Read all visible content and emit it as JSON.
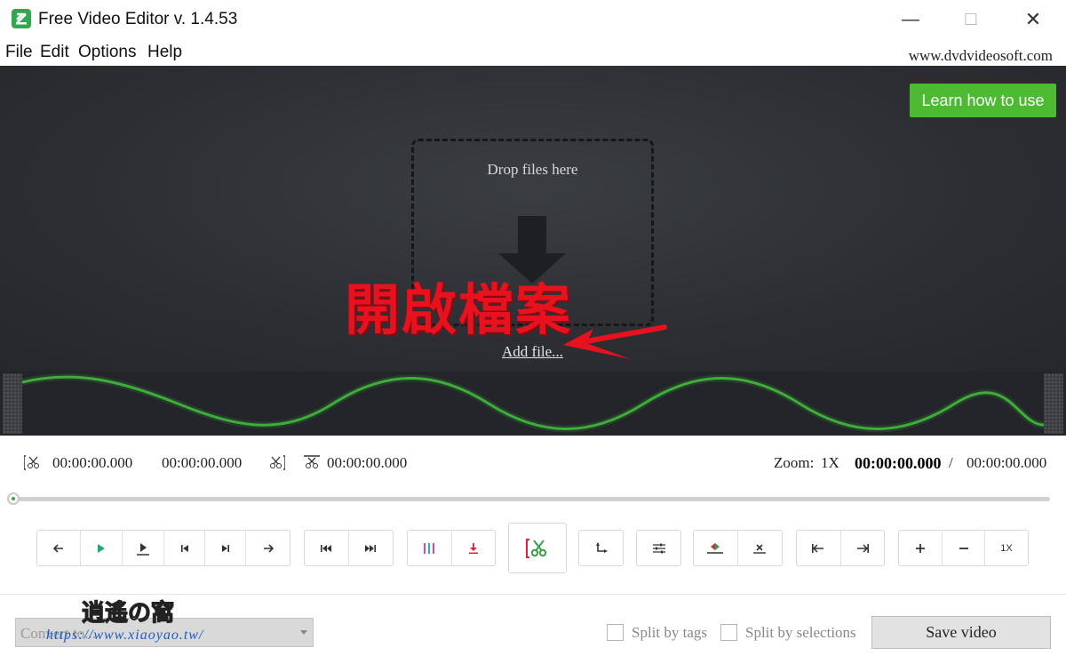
{
  "window": {
    "title": "Free Video Editor v. 1.4.53",
    "minimize": "—",
    "maximize": "☐",
    "close": "✕"
  },
  "menu": {
    "items": [
      "File",
      "Edit",
      "Options",
      "Help"
    ],
    "site": "www.dvdvideosoft.com"
  },
  "preview": {
    "learn_button": "Learn how to use",
    "drop_text": "Drop files here",
    "overlay_text": "開啟檔案",
    "add_file": "Add file..."
  },
  "times": {
    "start": "00:00:00.000",
    "middle": "00:00:00.000",
    "end": "00:00:00.000",
    "zoom_label": "Zoom:",
    "zoom_value": "1X",
    "current": "00:00:00.000",
    "separator": "/",
    "total": "00:00:00.000"
  },
  "toolbar": {
    "zoom_reset": "1X"
  },
  "bottom": {
    "convert_placeholder": "Convert to...",
    "watermark": "https://www.xiaoyao.tw/",
    "split_tags": "Split by tags",
    "split_selections": "Split by selections",
    "save": "Save video"
  },
  "colors": {
    "accent_green": "#4cbb32",
    "waveform": "#3fae3a",
    "overlay_red": "#e8121e"
  }
}
